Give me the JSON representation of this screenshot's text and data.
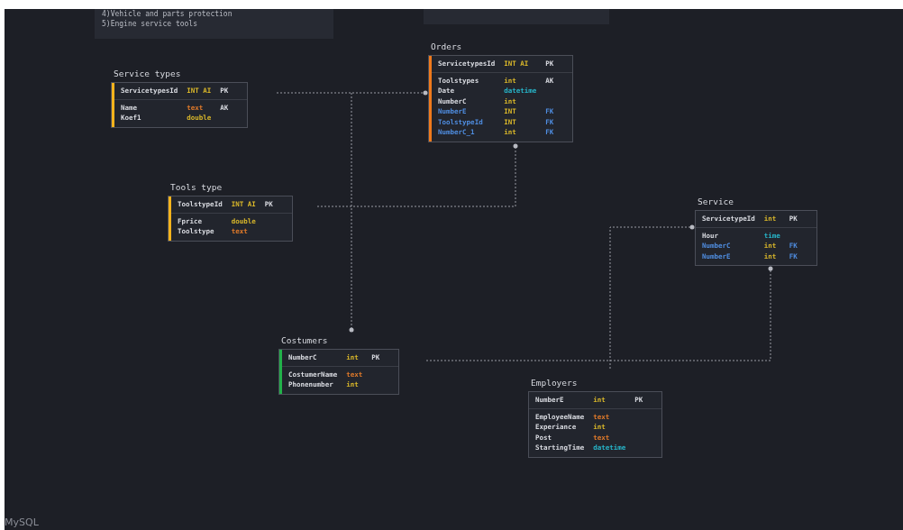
{
  "notes": [
    {
      "lines": [
        "4)Vehicle and parts protection",
        "5)Engine service tools"
      ]
    }
  ],
  "tables": [
    {
      "title": "Service types",
      "color": "#f5b31c",
      "fields": [
        {
          "name": "ServicetypesId",
          "type": "INT AI",
          "color": "#d8b62a",
          "key": "PK",
          "fk": false
        },
        {
          "name": "Name",
          "type": "text",
          "color": "#e07a2a",
          "key": "AK",
          "fk": false
        },
        {
          "name": "Koef1",
          "type": "double",
          "color": "#d8b62a",
          "fk": false
        }
      ]
    },
    {
      "title": "Orders",
      "color": "#f07a1c",
      "fields": [
        {
          "name": "ServicetypesId",
          "type": "INT AI",
          "color": "#d8b62a",
          "key": "PK",
          "fk": false
        },
        {
          "name": "Toolstypes",
          "type": "int",
          "color": "#d8b62a",
          "key": "AK",
          "fk": false
        },
        {
          "name": "Date",
          "type": "datetime",
          "color": "#27b5c9",
          "fk": false
        },
        {
          "name": "NumberC",
          "type": "int",
          "color": "#d8b62a",
          "fk": false
        },
        {
          "name": "NumberE",
          "type": "INT",
          "color": "#d8b62a",
          "key": "FK",
          "fk": true
        },
        {
          "name": "ToolstypeId",
          "type": "INT",
          "color": "#d8b62a",
          "key": "FK",
          "fk": true
        },
        {
          "name": "NumberC_1",
          "type": "int",
          "color": "#d8b62a",
          "key": "FK",
          "fk": true
        }
      ]
    },
    {
      "title": "Tools type",
      "color": "#f5b31c",
      "fields": [
        {
          "name": "ToolstypeId",
          "type": "INT AI",
          "color": "#d8b62a",
          "key": "PK",
          "fk": false
        },
        {
          "name": "Fprice",
          "type": "double",
          "color": "#d8b62a",
          "fk": false
        },
        {
          "name": "Toolstype",
          "type": "text",
          "color": "#e07a2a",
          "fk": false
        }
      ]
    },
    {
      "title": "Service",
      "fields": [
        {
          "name": "ServicetypeId",
          "type": "int",
          "color": "#d8b62a",
          "key": "PK",
          "fk": false
        },
        {
          "name": "Hour",
          "type": "time",
          "color": "#27b5c9",
          "fk": false
        },
        {
          "name": "NumberC",
          "type": "int",
          "color": "#d8b62a",
          "key": "FK",
          "fk": true
        },
        {
          "name": "NumberE",
          "type": "int",
          "color": "#d8b62a",
          "key": "FK",
          "fk": true
        }
      ]
    },
    {
      "title": "Costumers",
      "color": "#22b04a",
      "fields": [
        {
          "name": "NumberC",
          "type": "int",
          "color": "#d8b62a",
          "key": "PK",
          "fk": false
        },
        {
          "name": "CostumerName",
          "type": "text",
          "color": "#e07a2a",
          "fk": false
        },
        {
          "name": "Phonenumber",
          "type": "int",
          "color": "#d8b62a",
          "fk": false
        }
      ]
    },
    {
      "title": "Employers",
      "fields": [
        {
          "name": "NumberE",
          "type": "int",
          "color": "#d8b62a",
          "key": "PK",
          "fk": false
        },
        {
          "name": "EmployeeName",
          "type": "text",
          "color": "#e07a2a",
          "fk": false
        },
        {
          "name": "Experiance",
          "type": "int",
          "color": "#d8b62a",
          "fk": false
        },
        {
          "name": "Post",
          "type": "text",
          "color": "#e07a2a",
          "fk": false
        },
        {
          "name": "StartingTime",
          "type": "datetime",
          "color": "#27b5c9",
          "fk": false
        }
      ]
    }
  ],
  "footer": "MySQL"
}
